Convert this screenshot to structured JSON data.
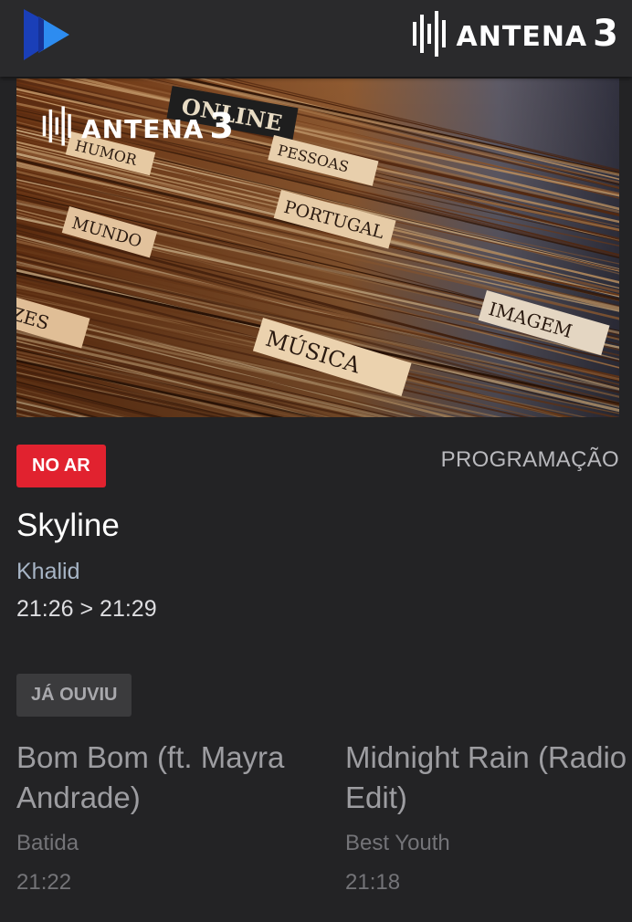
{
  "header": {
    "brand_name": "ANTENA",
    "brand_number": "3"
  },
  "hero": {
    "logo_name": "ANTENA",
    "logo_number": "3",
    "dividers": [
      "ONLINE",
      "HUMOR",
      "PESSOAS",
      "MUNDO",
      "PORTUGAL",
      "ZES",
      "MÚSICA",
      "IMAGEM"
    ]
  },
  "now_playing": {
    "badge": "NO AR",
    "schedule_link": "PROGRAMAÇÃO",
    "title": "Skyline",
    "artist": "Khalid",
    "time": "21:26 > 21:29"
  },
  "history": {
    "badge": "JÁ OUVIU",
    "items": [
      {
        "title": "Bom Bom (ft. Mayra Andrade)",
        "artist": "Batida",
        "time": "21:22"
      },
      {
        "title": "Midnight Rain (Radio Edit)",
        "artist": "Best Youth",
        "time": "21:18"
      }
    ]
  },
  "colors": {
    "background": "#232325",
    "topbar": "#2a2a2c",
    "onair_red": "#e1222f",
    "artist_blue": "#a7b5c6",
    "play_blue_light": "#2d8cf0",
    "play_blue_dark": "#1a3fb8"
  },
  "icons": [
    "play-logo-icon",
    "antena3-bars-icon"
  ]
}
